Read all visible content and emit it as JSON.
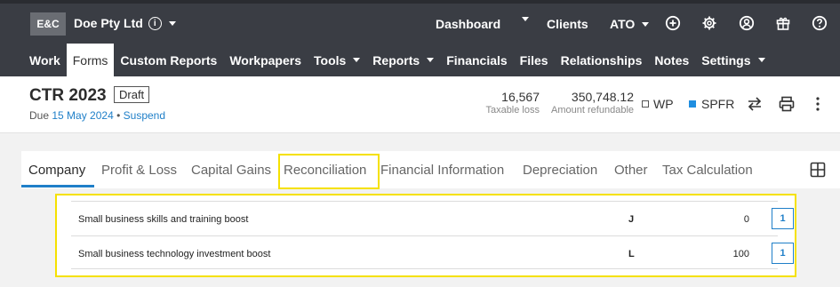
{
  "topbar": {
    "logo": "E&C",
    "company": "Doe Pty Ltd",
    "info_glyph": "i",
    "nav": {
      "dashboard": "Dashboard",
      "clients": "Clients",
      "ato": "ATO"
    },
    "icons": [
      "add-circle-icon",
      "gear-icon",
      "user-circle-icon",
      "gift-icon",
      "help-icon"
    ]
  },
  "menu": [
    {
      "label": "Work",
      "active": false,
      "dropdown": false
    },
    {
      "label": "Forms",
      "active": true,
      "dropdown": false
    },
    {
      "label": "Custom Reports",
      "active": false,
      "dropdown": false
    },
    {
      "label": "Workpapers",
      "active": false,
      "dropdown": false
    },
    {
      "label": "Tools",
      "active": false,
      "dropdown": true
    },
    {
      "label": "Reports",
      "active": false,
      "dropdown": true
    },
    {
      "label": "Financials",
      "active": false,
      "dropdown": false
    },
    {
      "label": "Files",
      "active": false,
      "dropdown": false
    },
    {
      "label": "Relationships",
      "active": false,
      "dropdown": false
    },
    {
      "label": "Notes",
      "active": false,
      "dropdown": false
    },
    {
      "label": "Settings",
      "active": false,
      "dropdown": true
    }
  ],
  "header": {
    "title": "CTR 2023",
    "badge": "Draft",
    "due_prefix": "Due",
    "due_date": "15 May 2024",
    "separator": "•",
    "suspend": "Suspend",
    "taxable_loss_value": "16,567",
    "taxable_loss_label": "Taxable loss",
    "refund_value": "350,748.12",
    "refund_label": "Amount refundable",
    "wp": "WP",
    "spfr": "SPFR"
  },
  "tabs": [
    {
      "label": "Company",
      "active": true
    },
    {
      "label": "Profit & Loss",
      "active": false
    },
    {
      "label": "Capital Gains",
      "active": false
    },
    {
      "label": "Reconciliation",
      "active": false
    },
    {
      "label": "Financial Information",
      "active": false
    },
    {
      "label": "Depreciation",
      "active": false
    },
    {
      "label": "Other",
      "active": false
    },
    {
      "label": "Tax Calculation",
      "active": false
    }
  ],
  "rows": [
    {
      "label": "Small business skills and training boost",
      "code": "J",
      "value": "0",
      "button": "1"
    },
    {
      "label": "Small business technology investment boost",
      "code": "L",
      "value": "100",
      "button": "1"
    }
  ],
  "colors": {
    "topbar": "#3a3d44",
    "accent": "#1f7fc8",
    "highlight": "#f5e100",
    "spfr_dot": "#1f8ee0"
  }
}
